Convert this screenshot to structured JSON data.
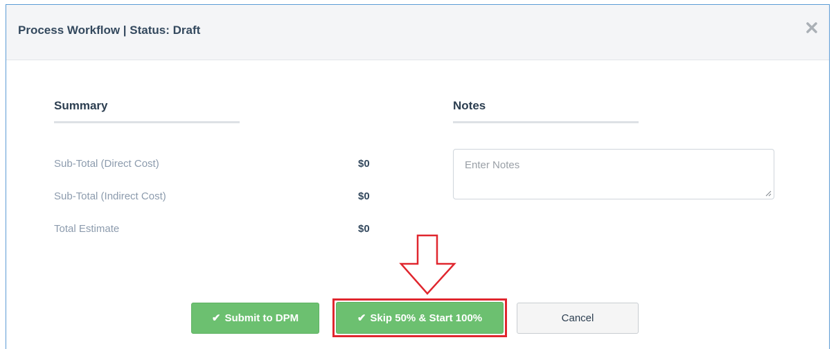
{
  "modal": {
    "title": "Process Workflow | Status: Draft",
    "close_icon": "close-icon"
  },
  "summary": {
    "heading": "Summary",
    "rows": [
      {
        "label": "Sub-Total (Direct Cost)",
        "value": "$0"
      },
      {
        "label": "Sub-Total (Indirect Cost)",
        "value": "$0"
      },
      {
        "label": "Total Estimate",
        "value": "$0"
      }
    ]
  },
  "notes": {
    "heading": "Notes",
    "placeholder": "Enter Notes",
    "value": ""
  },
  "actions": {
    "check_glyph": "✔",
    "submit_label": "Submit to DPM",
    "skip_label": "Skip 50% & Start 100%",
    "cancel_label": "Cancel"
  },
  "colors": {
    "primary_green": "#6cc070",
    "highlight_red": "#e0262e",
    "header_bg": "#f4f5f7",
    "border_blue": "#5b9bd5"
  }
}
